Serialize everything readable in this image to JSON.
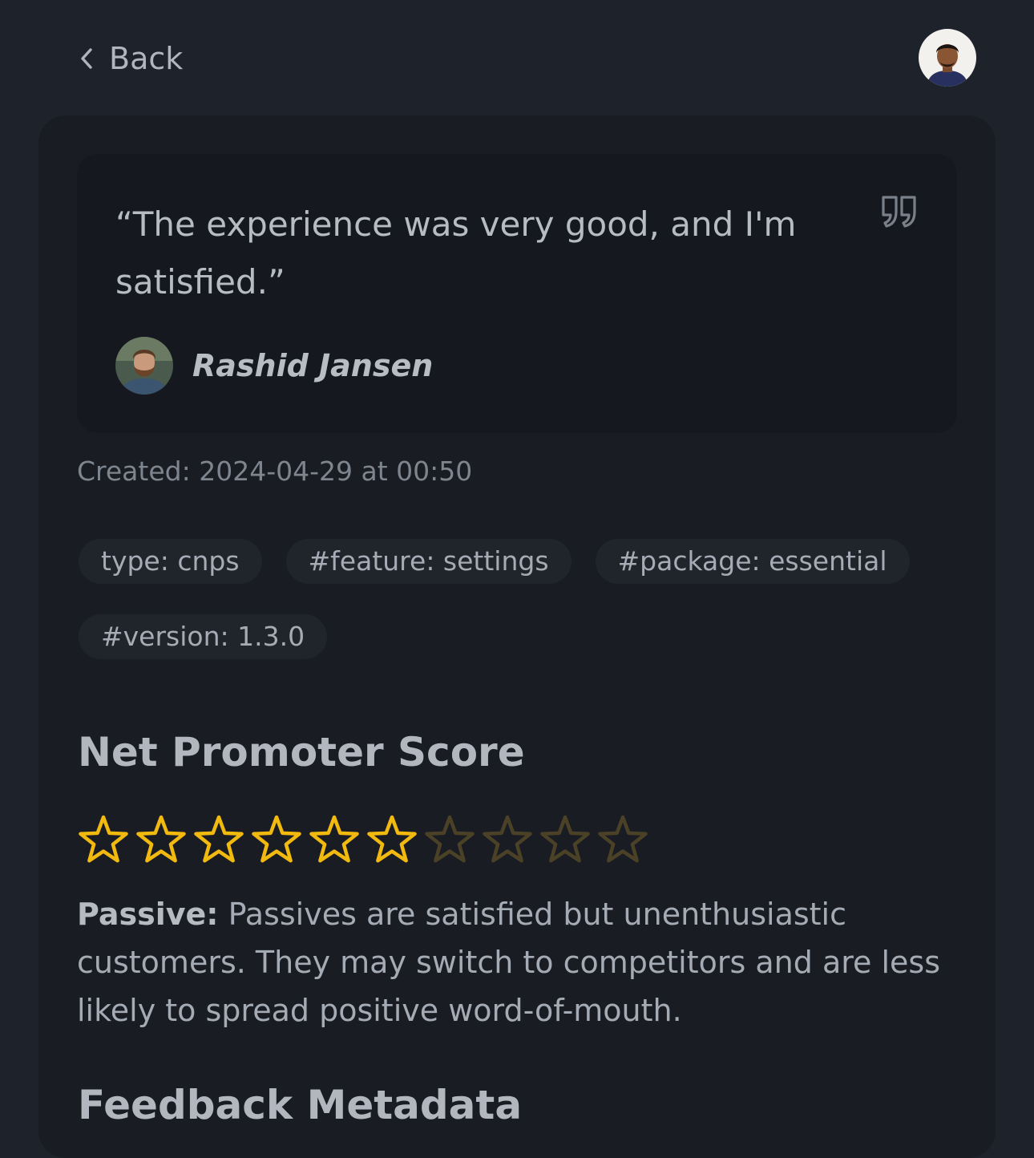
{
  "header": {
    "back_label": "Back",
    "back_icon": "chevron-left-icon",
    "avatar_icon": "user-avatar"
  },
  "testimonial": {
    "quote": "“The experience was very good, and I'm satisfied.”",
    "quote_icon": "quote-icon",
    "author_name": "Rashid Jansen"
  },
  "created": "Created: 2024-04-29 at 00:50",
  "tags": [
    "type: cnps",
    "#feature: settings",
    "#package: essential",
    "#version: 1.3.0"
  ],
  "nps": {
    "title": "Net Promoter Score",
    "score": 6,
    "max": 10,
    "category_label": "Passive:",
    "description": " Passives are satisfied but unenthusiastic customers. They may switch to competitors and are less likely to spread positive word-of-mouth."
  },
  "metadata": {
    "title": "Feedback Metadata"
  },
  "colors": {
    "background": "#1e232b",
    "panel": "#191c23",
    "card": "#15181e",
    "star_active": "#f2b90f",
    "star_inactive": "#4a4126"
  }
}
